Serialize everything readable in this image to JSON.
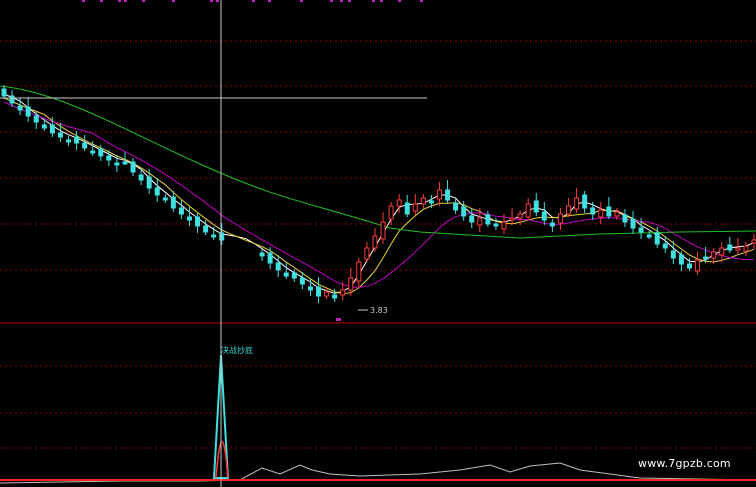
{
  "chart": {
    "low_price_label": "3.83",
    "signal_label": "决战抄底",
    "watermark": "www.7gpzb.com"
  },
  "colors": {
    "background": "#000000",
    "grid": "#8b0000",
    "divider": "#c00000",
    "up_candle": "#ff3b3b",
    "down_candle": "#40e0e0",
    "ma_short": "#ffffff",
    "ma_mid": "#e8d038",
    "ma_long": "#c000c0",
    "ma_slow": "#20c020",
    "indicator_spike": "#40e0e0",
    "indicator_line": "#c0c0c0",
    "baseline": "#ff2020",
    "crosshair": "#c8c8c8"
  },
  "chart_data": {
    "type": "candlestick",
    "close_series": [
      96,
      103,
      110,
      116,
      122,
      128,
      133,
      137,
      140,
      143,
      148,
      152,
      156,
      160,
      165,
      162,
      172,
      180,
      188,
      195,
      200,
      208,
      214,
      220,
      226,
      232,
      236,
      240,
      236,
      240,
      246,
      250,
      256,
      263,
      270,
      276,
      278,
      284,
      290,
      296,
      292,
      298,
      290,
      278,
      262,
      248,
      236,
      222,
      206,
      200,
      214,
      204,
      198,
      202,
      190,
      200,
      210,
      216,
      222,
      218,
      224,
      226,
      222,
      218,
      214,
      204,
      212,
      220,
      226,
      214,
      206,
      198,
      208,
      214,
      210,
      216,
      212,
      222,
      228,
      232,
      236,
      244,
      248,
      258,
      264,
      268,
      260,
      258,
      252,
      248,
      250,
      248,
      246,
      240
    ],
    "low_marker": "3.83",
    "signal": "决战抄底"
  }
}
